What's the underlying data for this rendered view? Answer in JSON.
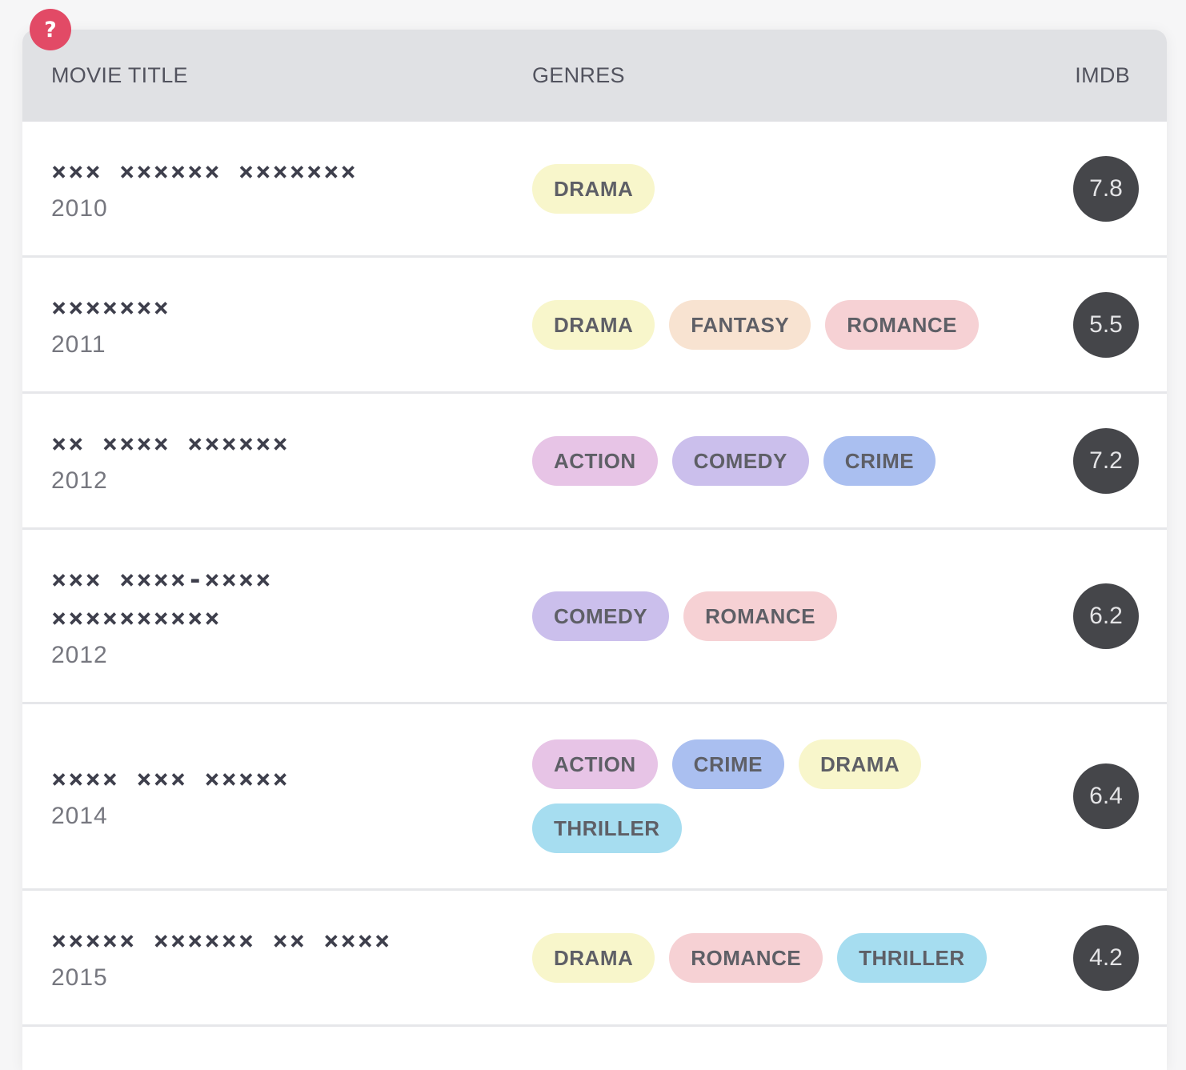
{
  "help": {
    "label": "?"
  },
  "header": {
    "title": "MOVIE TITLE",
    "genres": "GENRES",
    "imdb": "IMDB"
  },
  "genre_colors": {
    "DRAMA": "#f8f6cb",
    "FANTASY": "#f8e3d1",
    "ROMANCE": "#f6d1d4",
    "ACTION": "#e7c4e6",
    "COMEDY": "#cbbfec",
    "CRIME": "#aabff0",
    "THRILLER": "#a6ddf0"
  },
  "rows": [
    {
      "title": "××× ×××××× ×××××××",
      "year": "2010",
      "genres": [
        "DRAMA"
      ],
      "rating": "7.8"
    },
    {
      "title": "×××××××",
      "year": "2011",
      "genres": [
        "DRAMA",
        "FANTASY",
        "ROMANCE"
      ],
      "rating": "5.5"
    },
    {
      "title": "×× ×××× ××××××",
      "year": "2012",
      "genres": [
        "ACTION",
        "COMEDY",
        "CRIME"
      ],
      "rating": "7.2"
    },
    {
      "title": "××× ××××-×××× ××××××××××",
      "year": "2012",
      "genres": [
        "COMEDY",
        "ROMANCE"
      ],
      "rating": "6.2"
    },
    {
      "title": "×××× ××× ×××××",
      "year": "2014",
      "genres": [
        "ACTION",
        "CRIME",
        "DRAMA",
        "THRILLER"
      ],
      "rating": "6.4"
    },
    {
      "title": "××××× ×××××× ×× ××××",
      "year": "2015",
      "genres": [
        "DRAMA",
        "ROMANCE",
        "THRILLER"
      ],
      "rating": "4.2"
    }
  ]
}
